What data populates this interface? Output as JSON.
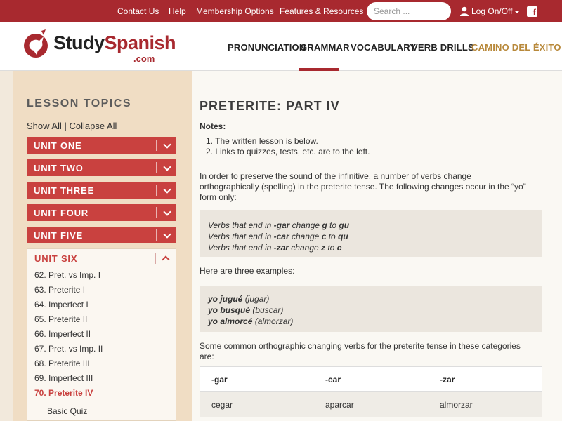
{
  "topbar": {
    "links": [
      "Contact Us",
      "Help",
      "Membership Options",
      "Features & Resources"
    ],
    "search_placeholder": "Search ...",
    "login_label": "Log On/Off",
    "facebook_glyph": "f",
    "bar_color": "#a8292f"
  },
  "logo": {
    "study": "Study",
    "spanish": "Spanish",
    "com": ".com"
  },
  "nav": {
    "items": [
      "PRONUNCIATION",
      "GRAMMAR",
      "VOCABULARY",
      "VERB DRILLS",
      "CAMINO DEL ÉXITO"
    ],
    "active": "GRAMMAR"
  },
  "sidebar": {
    "title": "LESSON TOPICS",
    "show_all": "Show All",
    "separator": " | ",
    "collapse_all": "Collapse All",
    "units": [
      "UNIT ONE",
      "UNIT TWO",
      "UNIT THREE",
      "UNIT FOUR",
      "UNIT FIVE"
    ],
    "open_unit": {
      "title": "UNIT SIX",
      "lessons": [
        "62. Pret. vs Imp. I",
        "63. Preterite I",
        "64. Imperfect I",
        "65. Preterite II",
        "66. Imperfect II",
        "67. Pret. vs Imp. II",
        "68. Preterite III",
        "69. Imperfect III",
        "70. Preterite IV"
      ],
      "active_lesson": "70. Preterite IV",
      "sub_item": "Basic Quiz"
    },
    "unit_color": "#c9413f"
  },
  "main": {
    "title": "PRETERITE: PART IV",
    "notes_heading": "Notes:",
    "notes": [
      "The written lesson is below.",
      "Links to quizzes, tests, etc. are to the left."
    ],
    "intro": "In order to preserve the sound of the infinitive, a number of verbs change orthographically (spelling) in the preterite tense. The following changes occur in the “yo” form only:",
    "rules": [
      {
        "pre": "Verbs that end in ",
        "ending": "-gar",
        "mid": " change ",
        "from": "g",
        "to_word": " to ",
        "to": "gu"
      },
      {
        "pre": "Verbs that end in ",
        "ending": "-car",
        "mid": " change ",
        "from": "c",
        "to_word": " to ",
        "to": "qu"
      },
      {
        "pre": "Verbs that end in ",
        "ending": "-zar",
        "mid": " change ",
        "from": "z",
        "to_word": " to ",
        "to": "c"
      }
    ],
    "examples_intro": "Here are three examples:",
    "examples": [
      {
        "form": "yo jugué",
        "inf": "(jugar)"
      },
      {
        "form": "yo busqué",
        "inf": "(buscar)"
      },
      {
        "form": "yo almorcé",
        "inf": "(almorzar)"
      }
    ],
    "common_intro": "Some common orthographic changing verbs for the preterite tense in these categories are:",
    "table": {
      "headers": [
        "-gar",
        "-car",
        "-zar"
      ],
      "rows": [
        [
          "cegar",
          "aparcar",
          "almorzar"
        ]
      ]
    }
  }
}
